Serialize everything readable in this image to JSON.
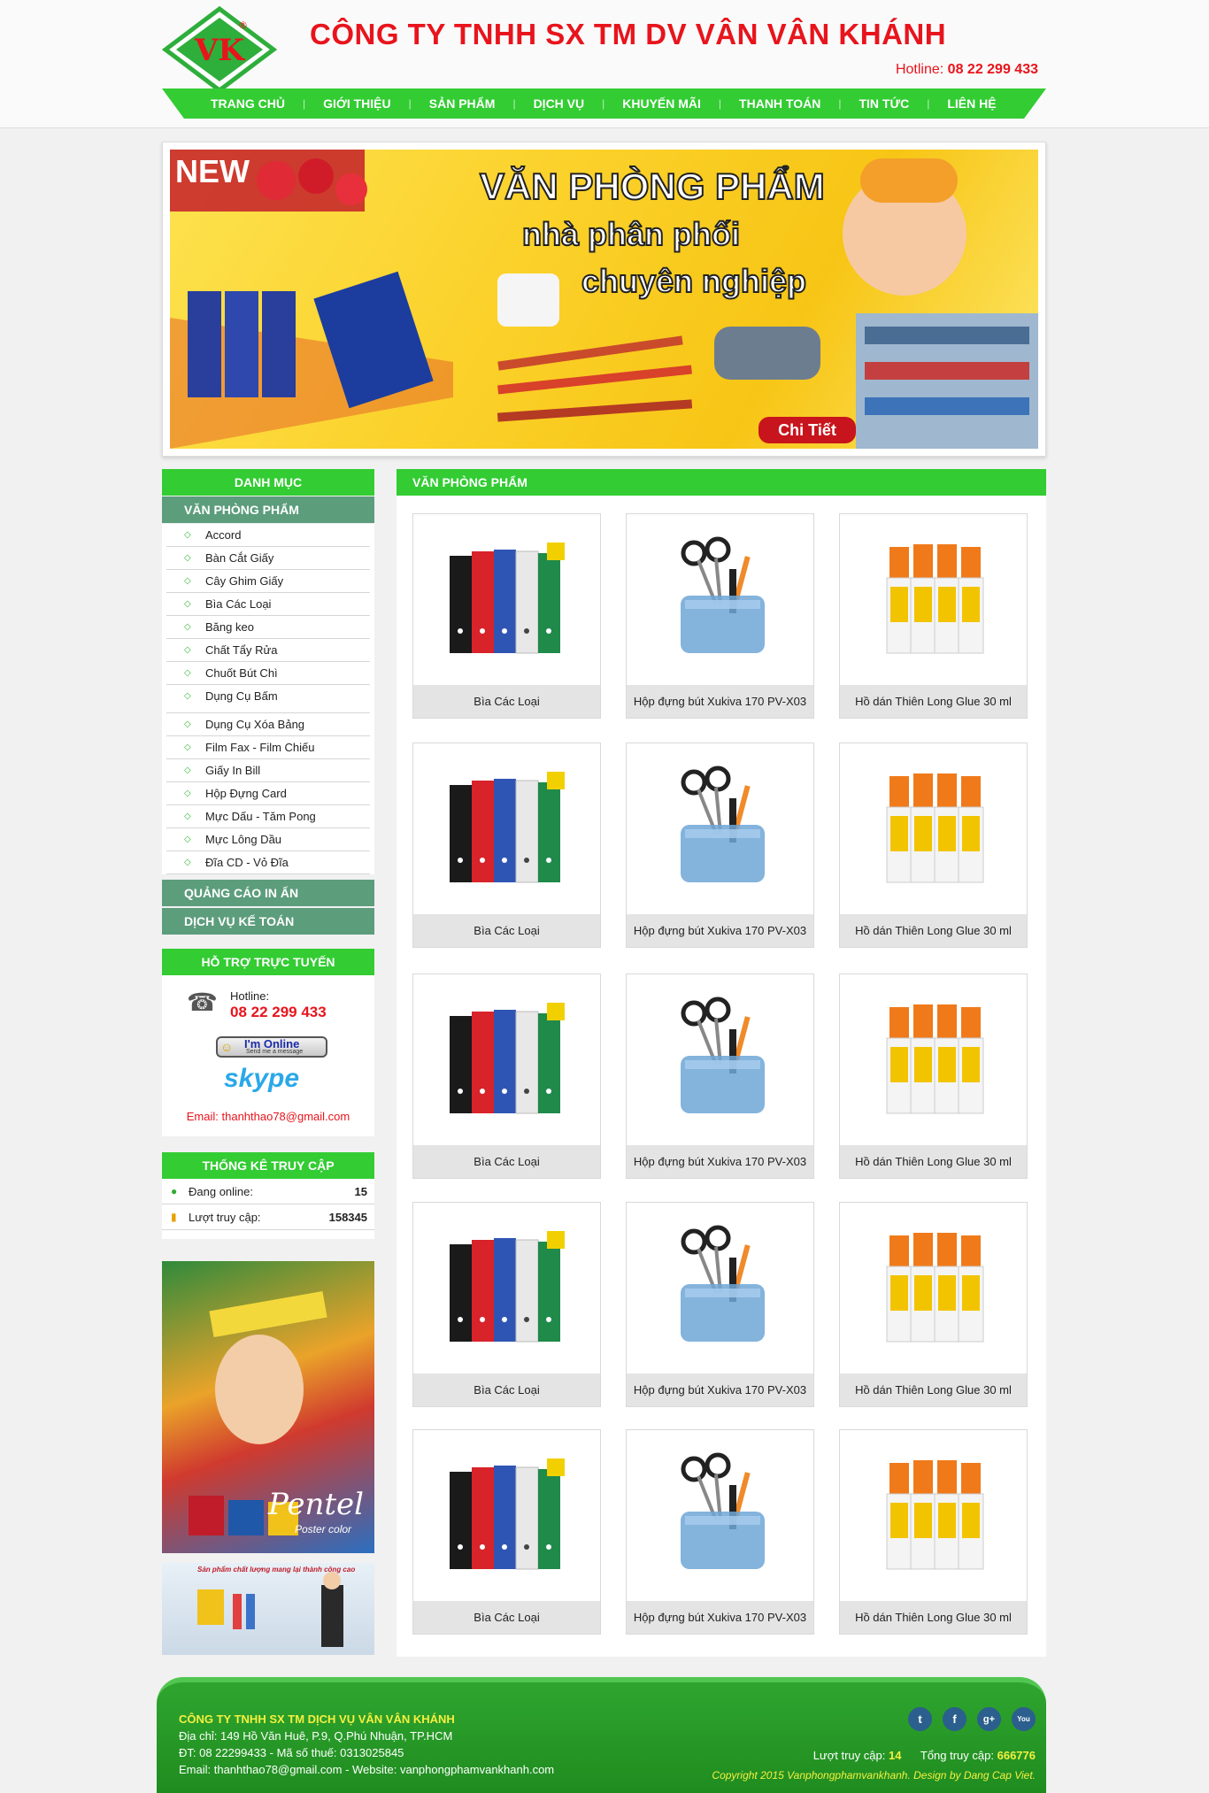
{
  "header": {
    "company": "CÔNG TY TNHH SX TM DV VÂN VÂN KHÁNH",
    "hotline_label": "Hotline:",
    "hotline_number": "08 22 299 433",
    "logo_text": "VK",
    "logo_mark": "®"
  },
  "nav": [
    "TRANG CHỦ",
    "GIỚI THIỆU",
    "SẢN PHẨM",
    "DỊCH VỤ",
    "KHUYẾN MÃI",
    "THANH TOÁN",
    "TIN TỨC",
    "LIÊN HỆ"
  ],
  "banner": {
    "new": "NEW",
    "line1": "VĂN PHÒNG PHẨM",
    "line2": "nhà phân phối",
    "line3": "chuyên nghiệp",
    "button": "Chi Tiết"
  },
  "sidebar": {
    "category_title": "DANH MỤC",
    "group_office": "VĂN PHÒNG PHẨM",
    "items": [
      "Accord",
      "Bàn Cắt Giấy",
      "Cây Ghim Giấy",
      "Bìa Các Loại",
      "Băng keo",
      "Chất Tẩy Rửa",
      "Chuốt Bút Chì",
      "Dụng Cụ Bấm",
      "Dụng Cụ Xóa Bảng",
      "Film Fax - Film Chiếu",
      "Giấy In Bill",
      "Hộp Đựng Card",
      "Mực Dấu - Tăm Pong",
      "Mực Lông Dầu",
      "Đĩa CD - Vỏ Đĩa"
    ],
    "group_ads": "QUẢNG CÁO IN ẤN",
    "group_accounting": "DỊCH VỤ KẾ TOÁN",
    "support_title": "HỖ TRỢ TRỰC TUYẾN",
    "support_hotline_label": "Hotline:",
    "support_hotline": "08 22  299 433",
    "yahoo_online": "I'm Online",
    "yahoo_sub": "Send me a message",
    "skype": "skype",
    "email": "Email: thanhthao78@gmail.com",
    "stats_title": "THỐNG KÊ TRUY CẬP",
    "online_label": "Đang online:",
    "online_value": "15",
    "visits_label": "Lượt truy cập:",
    "visits_value": "158345",
    "ad1_brand": "Pentel",
    "ad1_sub": "Poster color",
    "ad2_text": "Sản phẩm chất lượng mang lại thành công cao"
  },
  "main": {
    "title": "VĂN PHÒNG PHẨM",
    "products": [
      {
        "name": "Bìa Các Loại",
        "kind": "binders"
      },
      {
        "name": "Hộp đựng bút Xukiva 170 PV-X03",
        "kind": "penholder"
      },
      {
        "name": "Hồ dán Thiên Long Glue 30 ml",
        "kind": "glue"
      }
    ]
  },
  "footer": {
    "company": "CÔNG TY TNHH SX TM DỊCH VỤ VÂN VÂN KHÁNH",
    "address": "Địa chỉ: 149 Hồ Văn Huê, P.9, Q.Phú Nhuận, TP.HCM",
    "phone_tax": "ĐT: 08 22299433    -    Mã số thuế: 0313025845",
    "email_web": "Email: thanhthao78@gmail.com - Website: vanphongphamvankhanh.com",
    "visits_label": "Lượt truy cập:",
    "visits_value": "14",
    "total_label": "Tổng truy cập:",
    "total_value": "666776",
    "copyright": "Copyright 2015 Vanphongphamvankhanh. Design by Dang Cap Viet.",
    "social": [
      "t",
      "f",
      "g+",
      "You"
    ]
  },
  "colors": {
    "accent_green": "#33cc33",
    "category_green": "#5c9d7c",
    "brand_red": "#e8141c",
    "footer_yellow": "#f4f040"
  }
}
